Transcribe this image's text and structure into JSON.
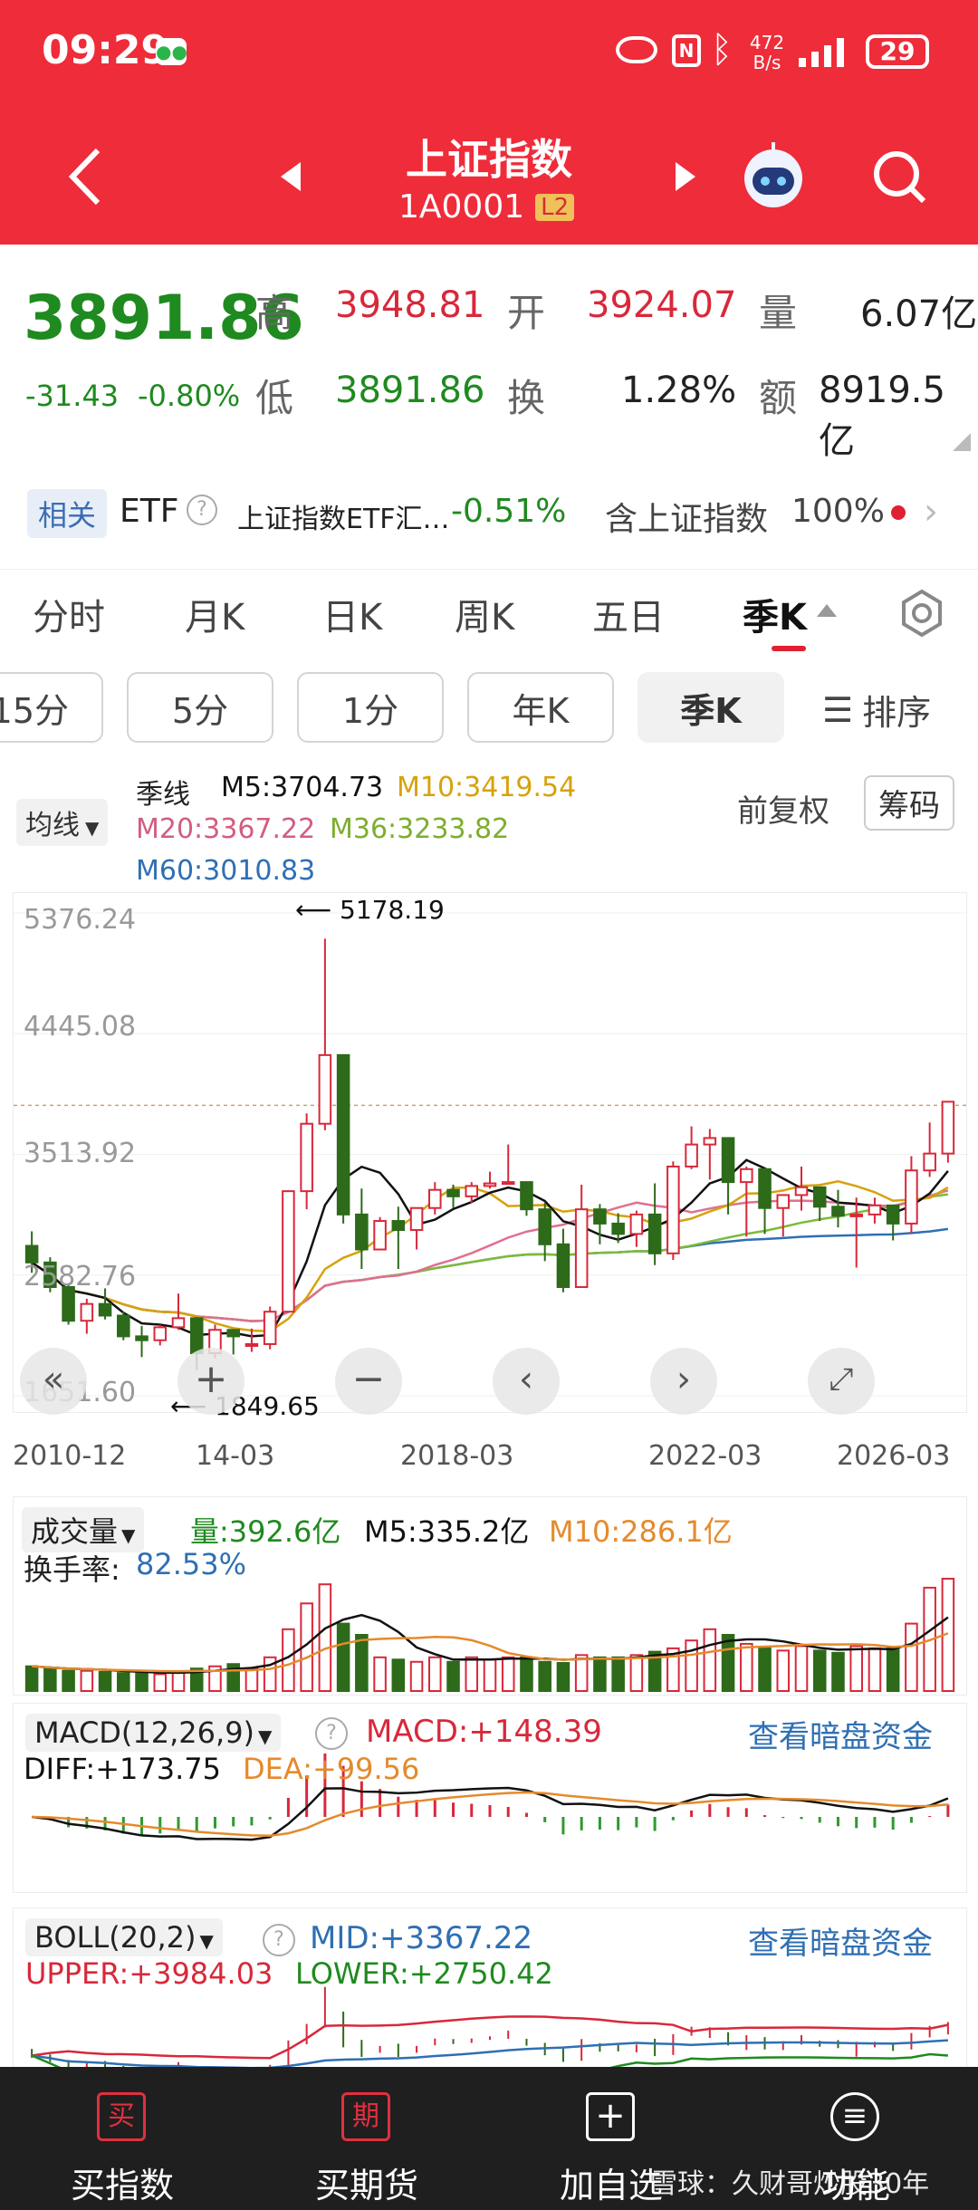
{
  "status": {
    "time": "09:29",
    "net_speed_value": "472",
    "net_speed_unit": "B/s",
    "battery": "29"
  },
  "header": {
    "title": "上证指数",
    "code": "1A0001",
    "level_badge": "L2"
  },
  "quote": {
    "price": "3891.86",
    "change": "-31.43",
    "change_pct": "-0.80%",
    "high_label": "高",
    "high": "3948.81",
    "open_label": "开",
    "open": "3924.07",
    "vol_label": "量",
    "vol": "6.07亿",
    "low_label": "低",
    "low": "3891.86",
    "turnover_label": "换",
    "turnover": "1.28%",
    "amt_label": "额",
    "amt": "8919.5亿"
  },
  "etf": {
    "tag": "相关",
    "label": "ETF",
    "name": "上证指数ETF汇…",
    "pct": "-0.51%",
    "contain_text": "含上证指数",
    "contain_pct": "100%"
  },
  "tabs": [
    "分时",
    "月K",
    "日K",
    "周K",
    "五日",
    "季K"
  ],
  "periods": [
    "15分",
    "5分",
    "1分",
    "年K",
    "季K",
    "排序"
  ],
  "kline": {
    "ma_type": "均线",
    "period_label": "季线",
    "m5": "M5:3704.73",
    "m10": "M10:3419.54",
    "m20": "M20:3367.22",
    "m36": "M36:3233.82",
    "m60": "M60:3010.83",
    "adj": "前复权",
    "chips": "筹码",
    "y_ticks": [
      "5376.24",
      "4445.08",
      "3513.92",
      "2582.76",
      "1651.60"
    ],
    "x_ticks": [
      "2010-12",
      "14-03",
      "2018-03",
      "2022-03",
      "2026-03"
    ],
    "max_label": "5178.19",
    "min_label": "1849.65",
    "colors": {
      "up": "#d8283a",
      "down": "#2d6a1a",
      "m5": "#111111",
      "m10": "#d7a20a",
      "m20": "#e07090",
      "m36": "#7dbb3a",
      "m60": "#2f6fb3"
    }
  },
  "chart_data": {
    "type": "candlestick",
    "title": "上证指数 季线",
    "ylim": [
      1651.6,
      5376.24
    ],
    "series": [
      {
        "name": "quarter",
        "ohlc": [
          [
            2808,
            2920,
            2600,
            2680
          ],
          [
            2680,
            2720,
            2450,
            2490
          ],
          [
            2490,
            2520,
            2200,
            2230
          ],
          [
            2230,
            2400,
            2130,
            2360
          ],
          [
            2360,
            2480,
            2240,
            2270
          ],
          [
            2270,
            2300,
            2080,
            2110
          ],
          [
            2110,
            2190,
            1950,
            2080
          ],
          [
            2080,
            2200,
            2040,
            2180
          ],
          [
            2180,
            2440,
            2160,
            2250
          ],
          [
            2250,
            2260,
            1850,
            1980
          ],
          [
            1980,
            2200,
            1940,
            2160
          ],
          [
            2160,
            2120,
            1970,
            2110
          ],
          [
            2040,
            2170,
            1990,
            2050
          ],
          [
            2050,
            2340,
            2010,
            2300
          ],
          [
            2300,
            3230,
            2300,
            3230
          ],
          [
            3230,
            3830,
            3090,
            3750
          ],
          [
            3750,
            5178,
            3700,
            4280
          ],
          [
            4280,
            4280,
            2980,
            3050
          ],
          [
            3050,
            3250,
            2630,
            2780
          ],
          [
            2780,
            3030,
            2780,
            3000
          ],
          [
            3000,
            3110,
            2630,
            2930
          ],
          [
            2930,
            3030,
            2780,
            3100
          ],
          [
            3100,
            3300,
            3050,
            3240
          ],
          [
            3240,
            3280,
            3100,
            3190
          ],
          [
            3190,
            3300,
            3140,
            3270
          ],
          [
            3270,
            3380,
            3250,
            3290
          ],
          [
            3290,
            3590,
            3290,
            3300
          ],
          [
            3300,
            3290,
            3040,
            3090
          ],
          [
            3090,
            3140,
            2690,
            2820
          ],
          [
            2820,
            2940,
            2450,
            2490
          ],
          [
            2490,
            3280,
            2490,
            3090
          ],
          [
            3090,
            3130,
            2820,
            2980
          ],
          [
            2980,
            3060,
            2830,
            2900
          ],
          [
            2900,
            3080,
            2800,
            3050
          ],
          [
            3050,
            3290,
            2660,
            2750
          ],
          [
            2750,
            3460,
            2700,
            3420
          ],
          [
            3420,
            3730,
            3400,
            3590
          ],
          [
            3590,
            3710,
            3320,
            3640
          ],
          [
            3640,
            3530,
            3050,
            3300
          ],
          [
            3300,
            3420,
            2880,
            3400
          ],
          [
            3400,
            3350,
            2900,
            3100
          ],
          [
            3100,
            3200,
            2880,
            3200
          ],
          [
            3200,
            3420,
            3080,
            3260
          ],
          [
            3260,
            3220,
            3000,
            3110
          ],
          [
            3110,
            3240,
            2950,
            3040
          ],
          [
            3040,
            3180,
            2640,
            3050
          ],
          [
            3050,
            3180,
            2980,
            3120
          ],
          [
            3120,
            3080,
            2850,
            2980
          ],
          [
            2980,
            3500,
            2900,
            3390
          ],
          [
            3390,
            3760,
            3340,
            3520
          ],
          [
            3520,
            3900,
            3450,
            3920
          ]
        ]
      }
    ],
    "ma": {
      "M5": 3704.73,
      "M10": 3419.54,
      "M20": 3367.22,
      "M36": 3233.82,
      "M60": 3010.83
    }
  },
  "volume": {
    "title": "成交量",
    "qty": "量:392.6亿",
    "m5": "M5:335.2亿",
    "m10": "M10:286.1亿",
    "turnover_label": "换手率:",
    "turnover": "82.53%",
    "bars": [
      0.22,
      0.2,
      0.18,
      0.18,
      0.17,
      0.16,
      0.16,
      0.15,
      0.17,
      0.2,
      0.22,
      0.24,
      0.2,
      0.3,
      0.55,
      0.78,
      0.95,
      0.6,
      0.5,
      0.3,
      0.28,
      0.26,
      0.3,
      0.26,
      0.3,
      0.28,
      0.3,
      0.3,
      0.26,
      0.25,
      0.32,
      0.3,
      0.3,
      0.32,
      0.35,
      0.38,
      0.45,
      0.55,
      0.5,
      0.42,
      0.38,
      0.36,
      0.4,
      0.36,
      0.34,
      0.4,
      0.38,
      0.38,
      0.6,
      0.92,
      1.0
    ]
  },
  "macd": {
    "title": "MACD(12,26,9)",
    "macd": "MACD:+148.39",
    "diff": "DIFF:+173.75",
    "dea": "DEA:+99.56",
    "link": "查看暗盘资金"
  },
  "boll": {
    "title": "BOLL(20,2)",
    "mid": "MID:+3367.22",
    "upper": "UPPER:+3984.03",
    "lower": "LOWER:+2750.42",
    "link": "查看暗盘资金"
  },
  "nav": [
    {
      "icon": "buy-index-icon",
      "glyph": "买",
      "label": "买指数"
    },
    {
      "icon": "buy-futures-icon",
      "glyph": "期",
      "label": "买期货"
    },
    {
      "icon": "add-watch-icon",
      "glyph": "+",
      "label": "加自选"
    },
    {
      "icon": "menu-icon",
      "glyph": "≡",
      "label": "功能"
    }
  ],
  "watermark": "雪球：久财哥炒股30年"
}
